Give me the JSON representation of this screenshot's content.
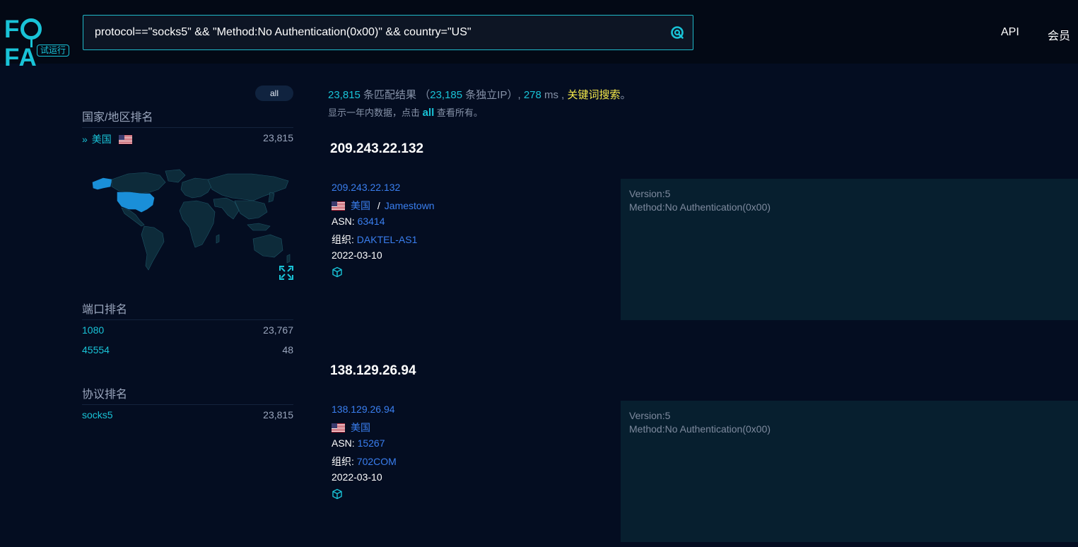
{
  "logo": {
    "text_before": "F",
    "text_after": "FA",
    "badge": "试运行"
  },
  "search": {
    "query": "protocol==\"socks5\" && \"Method:No Authentication(0x00)\" && country=\"US\""
  },
  "nav": {
    "api": "API",
    "member": "会员"
  },
  "sidebar": {
    "all_pill": "all",
    "country_title": "国家/地区排名",
    "countries": [
      {
        "label": "美国",
        "count": "23,815"
      }
    ],
    "port_title": "端口排名",
    "ports": [
      {
        "label": "1080",
        "count": "23,767"
      },
      {
        "label": "45554",
        "count": "48"
      }
    ],
    "protocol_title": "协议排名",
    "protocols": [
      {
        "label": "socks5",
        "count": "23,815"
      }
    ]
  },
  "summary": {
    "match_count": "23,815",
    "match_text": " 条匹配结果 （",
    "ip_count": "23,185",
    "ip_text": " 条独立IP）, ",
    "ms": "278",
    "ms_text": " ms , ",
    "keyword_search": "关键词搜索",
    "end": "。",
    "sub_before": "显示一年内数据，点击 ",
    "sub_all": "all",
    "sub_after": " 查看所有。"
  },
  "results": [
    {
      "title": "209.243.22.132",
      "ip_link": "209.243.22.132",
      "country": "美国",
      "sep": "/",
      "city": "Jamestown",
      "asn_label": "ASN:",
      "asn": "63414",
      "org_label": "组织:",
      "org": "DAKTEL-AS1",
      "date": "2022-03-10",
      "banner": [
        "Version:5",
        "Method:No Authentication(0x00)"
      ]
    },
    {
      "title": "138.129.26.94",
      "ip_link": "138.129.26.94",
      "country": "美国",
      "sep": "",
      "city": "",
      "asn_label": "ASN:",
      "asn": "15267",
      "org_label": "组织:",
      "org": "702COM",
      "date": "2022-03-10",
      "banner": [
        "Version:5",
        "Method:No Authentication(0x00)"
      ]
    }
  ],
  "colors": {
    "accent": "#19c3d7",
    "link": "#3a7ff0",
    "highlight": "#f5e94a",
    "background": "#040d21",
    "banner_bg": "#071f2f",
    "map_highlight": "#1a8fd8"
  }
}
